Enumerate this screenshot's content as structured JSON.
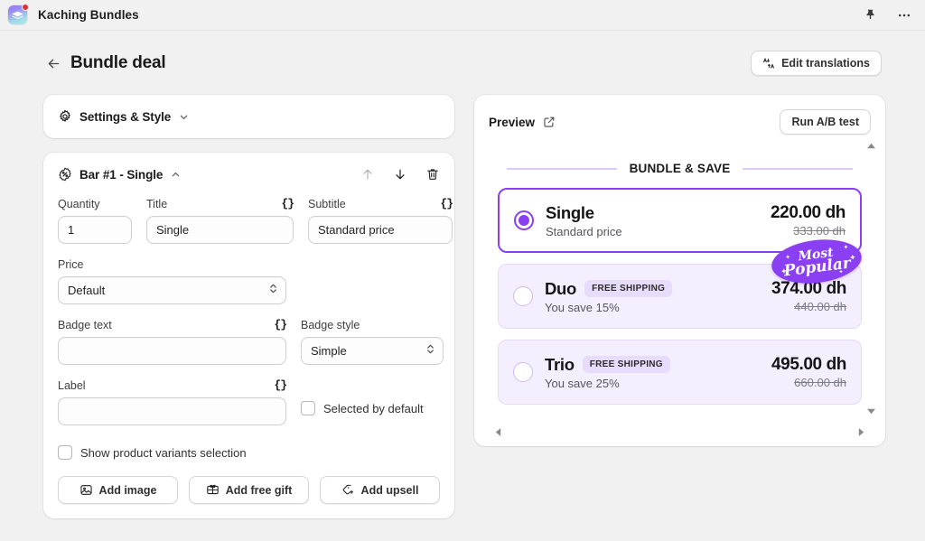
{
  "app": {
    "title": "Kaching Bundles",
    "icon": "app-layers-icon",
    "pin_icon": "pin-icon",
    "more_icon": "more-horizontal-icon"
  },
  "header": {
    "back_icon": "arrow-left-icon",
    "title": "Bundle deal",
    "edit_translations_label": "Edit translations",
    "edit_translations_icon": "translate-icon"
  },
  "settings_card": {
    "icon": "gear-icon",
    "title": "Settings & Style",
    "chevron": "chevron-down-icon"
  },
  "bar_card": {
    "icon": "discount-badge-icon",
    "title": "Bar #1 - Single",
    "chevron": "chevron-up-icon",
    "move_up_icon": "arrow-up-icon",
    "move_down_icon": "arrow-down-icon",
    "delete_icon": "trash-icon",
    "fields": {
      "quantity": {
        "label": "Quantity",
        "value": "1"
      },
      "title": {
        "label": "Title",
        "value": "Single",
        "braces": "{}"
      },
      "subtitle": {
        "label": "Subtitle",
        "value": "Standard price",
        "braces": "{}"
      },
      "price": {
        "label": "Price",
        "value": "Default"
      },
      "badge_text": {
        "label": "Badge text",
        "value": "",
        "braces": "{}"
      },
      "badge_style": {
        "label": "Badge style",
        "value": "Simple"
      },
      "label_field": {
        "label": "Label",
        "value": "",
        "braces": "{}"
      },
      "selected_by_default": {
        "label": "Selected by default",
        "checked": false
      },
      "show_variants": {
        "label": "Show product variants selection",
        "checked": false
      }
    },
    "actions": [
      {
        "label": "Add image",
        "icon": "image-icon"
      },
      {
        "label": "Add free gift",
        "icon": "gift-icon"
      },
      {
        "label": "Add upsell",
        "icon": "upsell-tag-icon"
      }
    ]
  },
  "preview": {
    "title": "Preview",
    "external_icon": "external-link-icon",
    "ab_test_label": "Run A/B test",
    "bundle_heading": "BUNDLE & SAVE",
    "accent_color": "#8b3ff3",
    "badge_bg": "#e7dcfb",
    "offers": [
      {
        "title": "Single",
        "subtitle": "Standard price",
        "shipping_badge": "",
        "price": "220.00 dh",
        "compare_price": "333.00 dh",
        "selected": true
      },
      {
        "title": "Duo",
        "subtitle": "You save 15%",
        "shipping_badge": "FREE SHIPPING",
        "price": "374.00 dh",
        "compare_price": "440.00 dh",
        "selected": false
      },
      {
        "title": "Trio",
        "subtitle": "You save 25%",
        "shipping_badge": "FREE SHIPPING",
        "price": "495.00 dh",
        "compare_price": "660.00 dh",
        "selected": false
      }
    ],
    "most_popular": {
      "line1": "Most",
      "line2": "Popular"
    },
    "scroll": {
      "up": "scroll-up-icon",
      "down": "scroll-down-icon",
      "left": "scroll-left-icon",
      "right": "scroll-right-icon"
    }
  }
}
